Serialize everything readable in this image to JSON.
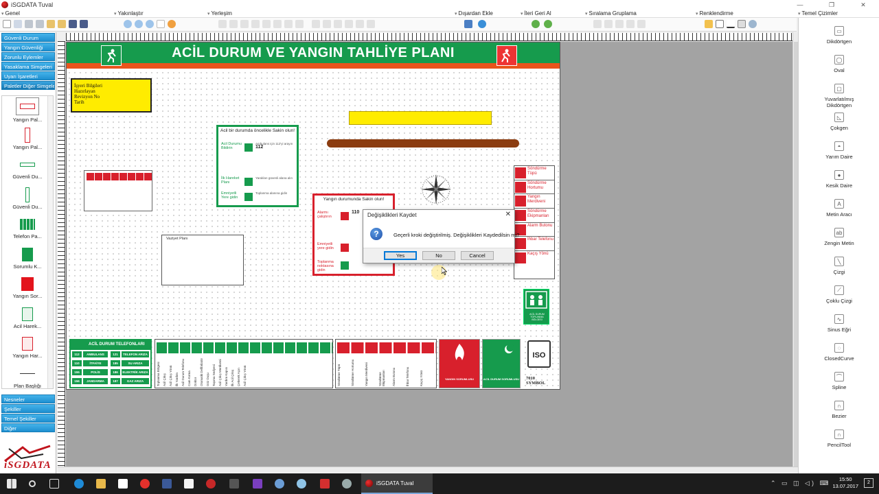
{
  "window": {
    "title": "iSGDATA Tuval",
    "minimize": "—",
    "maximize": "❐",
    "close": "✕"
  },
  "menu": [
    {
      "label": "Genel"
    },
    {
      "label": "Yakınlaştır"
    },
    {
      "label": "Yerleşim"
    },
    {
      "label": "Dışardan Ekle"
    },
    {
      "label": "İleri Geri Al"
    },
    {
      "label": "Sıralama Gruplama"
    },
    {
      "label": "Renklendirme"
    },
    {
      "label": "Temel Çizimler"
    }
  ],
  "left_panel": {
    "categories_top": [
      "Güvenli Durum",
      "Yangın Güvenliği",
      "Zorunlu Eylemler",
      "Yasaklama Simgeleri",
      "Uyarı İşaretleri",
      "Paletler Diğer Simgeler"
    ],
    "palette_items": [
      {
        "label": "Yangın Pal..."
      },
      {
        "label": "Yangın Pal..."
      },
      {
        "label": "Güvenli Du..."
      },
      {
        "label": "Güvenli Du..."
      },
      {
        "label": "Telefon Pa..."
      },
      {
        "label": "Sorumlu K..."
      },
      {
        "label": "Yangın Sor..."
      },
      {
        "label": "Acil Harek..."
      },
      {
        "label": "Yangın Har..."
      },
      {
        "label": "Plan Başlığı"
      }
    ],
    "categories_bottom": [
      "Nesneler",
      "Şekiller",
      "Temel Şekiller",
      "Diğer"
    ],
    "logo_text": "iSGDATA"
  },
  "plan": {
    "title": "ACİL DURUM VE YANGIN TAHLİYE PLANI",
    "info_box_lines": [
      "İşyeri Bilgileri",
      "Hazırlayan",
      "Revizyon No",
      "Tarih"
    ],
    "emergency_card": {
      "heading": "Acil bir durumda öncelikle Sakin olun!",
      "rows": [
        {
          "label": "Acil Durumu Bildirin",
          "text": "Ambulans için 112'yi arayın",
          "number": "112"
        },
        {
          "label": "İlk Hareket Planı",
          "text": "Yaralıları güvenli alana alın"
        },
        {
          "label": "Emniyetli Yere gidin",
          "text": "Toplanma alanına gidin"
        }
      ]
    },
    "fire_card": {
      "heading": "Yangın durumunda Sakin olun!",
      "rows": [
        {
          "label": "Alarmı çalıştırın",
          "number": "110"
        },
        {
          "label": "Emniyetli yere gidin"
        },
        {
          "label": "Toplanma noktasına gidin"
        }
      ]
    },
    "sketch_label": "Vaziyet Planı",
    "extinguisher_list": [
      "Söndürme Tüpü",
      "Söndürme Hortumu",
      "Yangın Merdiveni",
      "Söndürme Ekipmanları",
      "Alarm Butonu",
      "İhbar Telefonu",
      "Kaçış Yönü"
    ],
    "phone_table": {
      "title": "ACİL DURUM TELEFONLARI",
      "rows": [
        {
          "n1": "112",
          "l1": "AMBULANS",
          "n2": "121",
          "l2": "TELEFON ARIZA"
        },
        {
          "n1": "110",
          "l1": "İTFAİYE",
          "n2": "185",
          "l2": "SU ARIZA"
        },
        {
          "n1": "155",
          "l1": "POLİS",
          "n2": "186",
          "l2": "ELEKTRİK ARIZA"
        },
        {
          "n1": "156",
          "l1": "JANDARMA",
          "n2": "187",
          "l2": "GAZ ARIZA"
        }
      ]
    },
    "green_strip_labels": [
      "Toplanma Bölgesi",
      "Acil Çıkış",
      "Acil Çıkış Yönü",
      "İlk Yardım",
      "Acil Durum Telefonu",
      "Cam Kırma",
      "Doktor",
      "Otomatik Defibrilatör",
      "Göz Duşu",
      "Taşıma Sedyesi",
      "Acil Çıkış Merdiveni",
      "Yardım Kapısı",
      "İlk Acil Çıkış",
      "Çekerek Açın",
      "Acil Çıkış Yönü"
    ],
    "red_strip_labels": [
      "Söndürme Tüpü",
      "Söndürme Hortumu",
      "Yangın Merdiveni",
      "Söndürme Ekipmanları",
      "Alarm Butonu",
      "İhbar Telefonu",
      "Kaçış Yönü"
    ],
    "red_card_label": "YANGIN SORUMLUSU",
    "green_card_label": "ACİL DURUM SORUMLUSU",
    "assembly_label": "ACİL DURUM TOPLANMA BÖLGESİ",
    "iso_text": "ISO",
    "iso_caption": [
      "7010",
      "SYMBOL"
    ]
  },
  "dialog": {
    "title": "Değişiklikleri Kaydet",
    "message": "Geçerli kroki değiştirilmiş. Değişiklikleri Kaydedilsin mi?",
    "buttons": {
      "yes": "Yes",
      "no": "No",
      "cancel": "Cancel"
    }
  },
  "right_panel": {
    "items": [
      {
        "label": "Dikdörtgen",
        "icon": "rectangle-icon"
      },
      {
        "label": "Oval",
        "icon": "oval-icon"
      },
      {
        "label": "Yuvarlatılmış Dikdörtgen",
        "icon": "rounded-rectangle-icon"
      },
      {
        "label": "Çokgen",
        "icon": "polygon-icon"
      },
      {
        "label": "Yarım Daire",
        "icon": "half-circle-icon"
      },
      {
        "label": "Kesik Daire",
        "icon": "cut-circle-icon"
      },
      {
        "label": "Metin Aracı",
        "icon": "text-tool-icon"
      },
      {
        "label": "Zengin Metin",
        "icon": "rich-text-icon"
      },
      {
        "label": "Çizgi",
        "icon": "line-icon"
      },
      {
        "label": "Çoklu Çizgi",
        "icon": "polyline-icon"
      },
      {
        "label": "Sinus Eğri",
        "icon": "sine-curve-icon"
      },
      {
        "label": "ClosedCurve",
        "icon": "closed-curve-icon"
      },
      {
        "label": "Spline",
        "icon": "spline-icon"
      },
      {
        "label": "Bezier",
        "icon": "bezier-icon"
      },
      {
        "label": "PencilTool",
        "icon": "pencil-tool-icon"
      }
    ]
  },
  "taskbar": {
    "active_app": "iSGDATA Tuval",
    "time": "15:50",
    "date": "13.07.2017",
    "notifications": "2"
  },
  "colors": {
    "green": "#169b4d",
    "orange": "#e9541c",
    "red": "#d8202c",
    "yellow": "#ffec00",
    "accent": "#1d8fd0"
  }
}
